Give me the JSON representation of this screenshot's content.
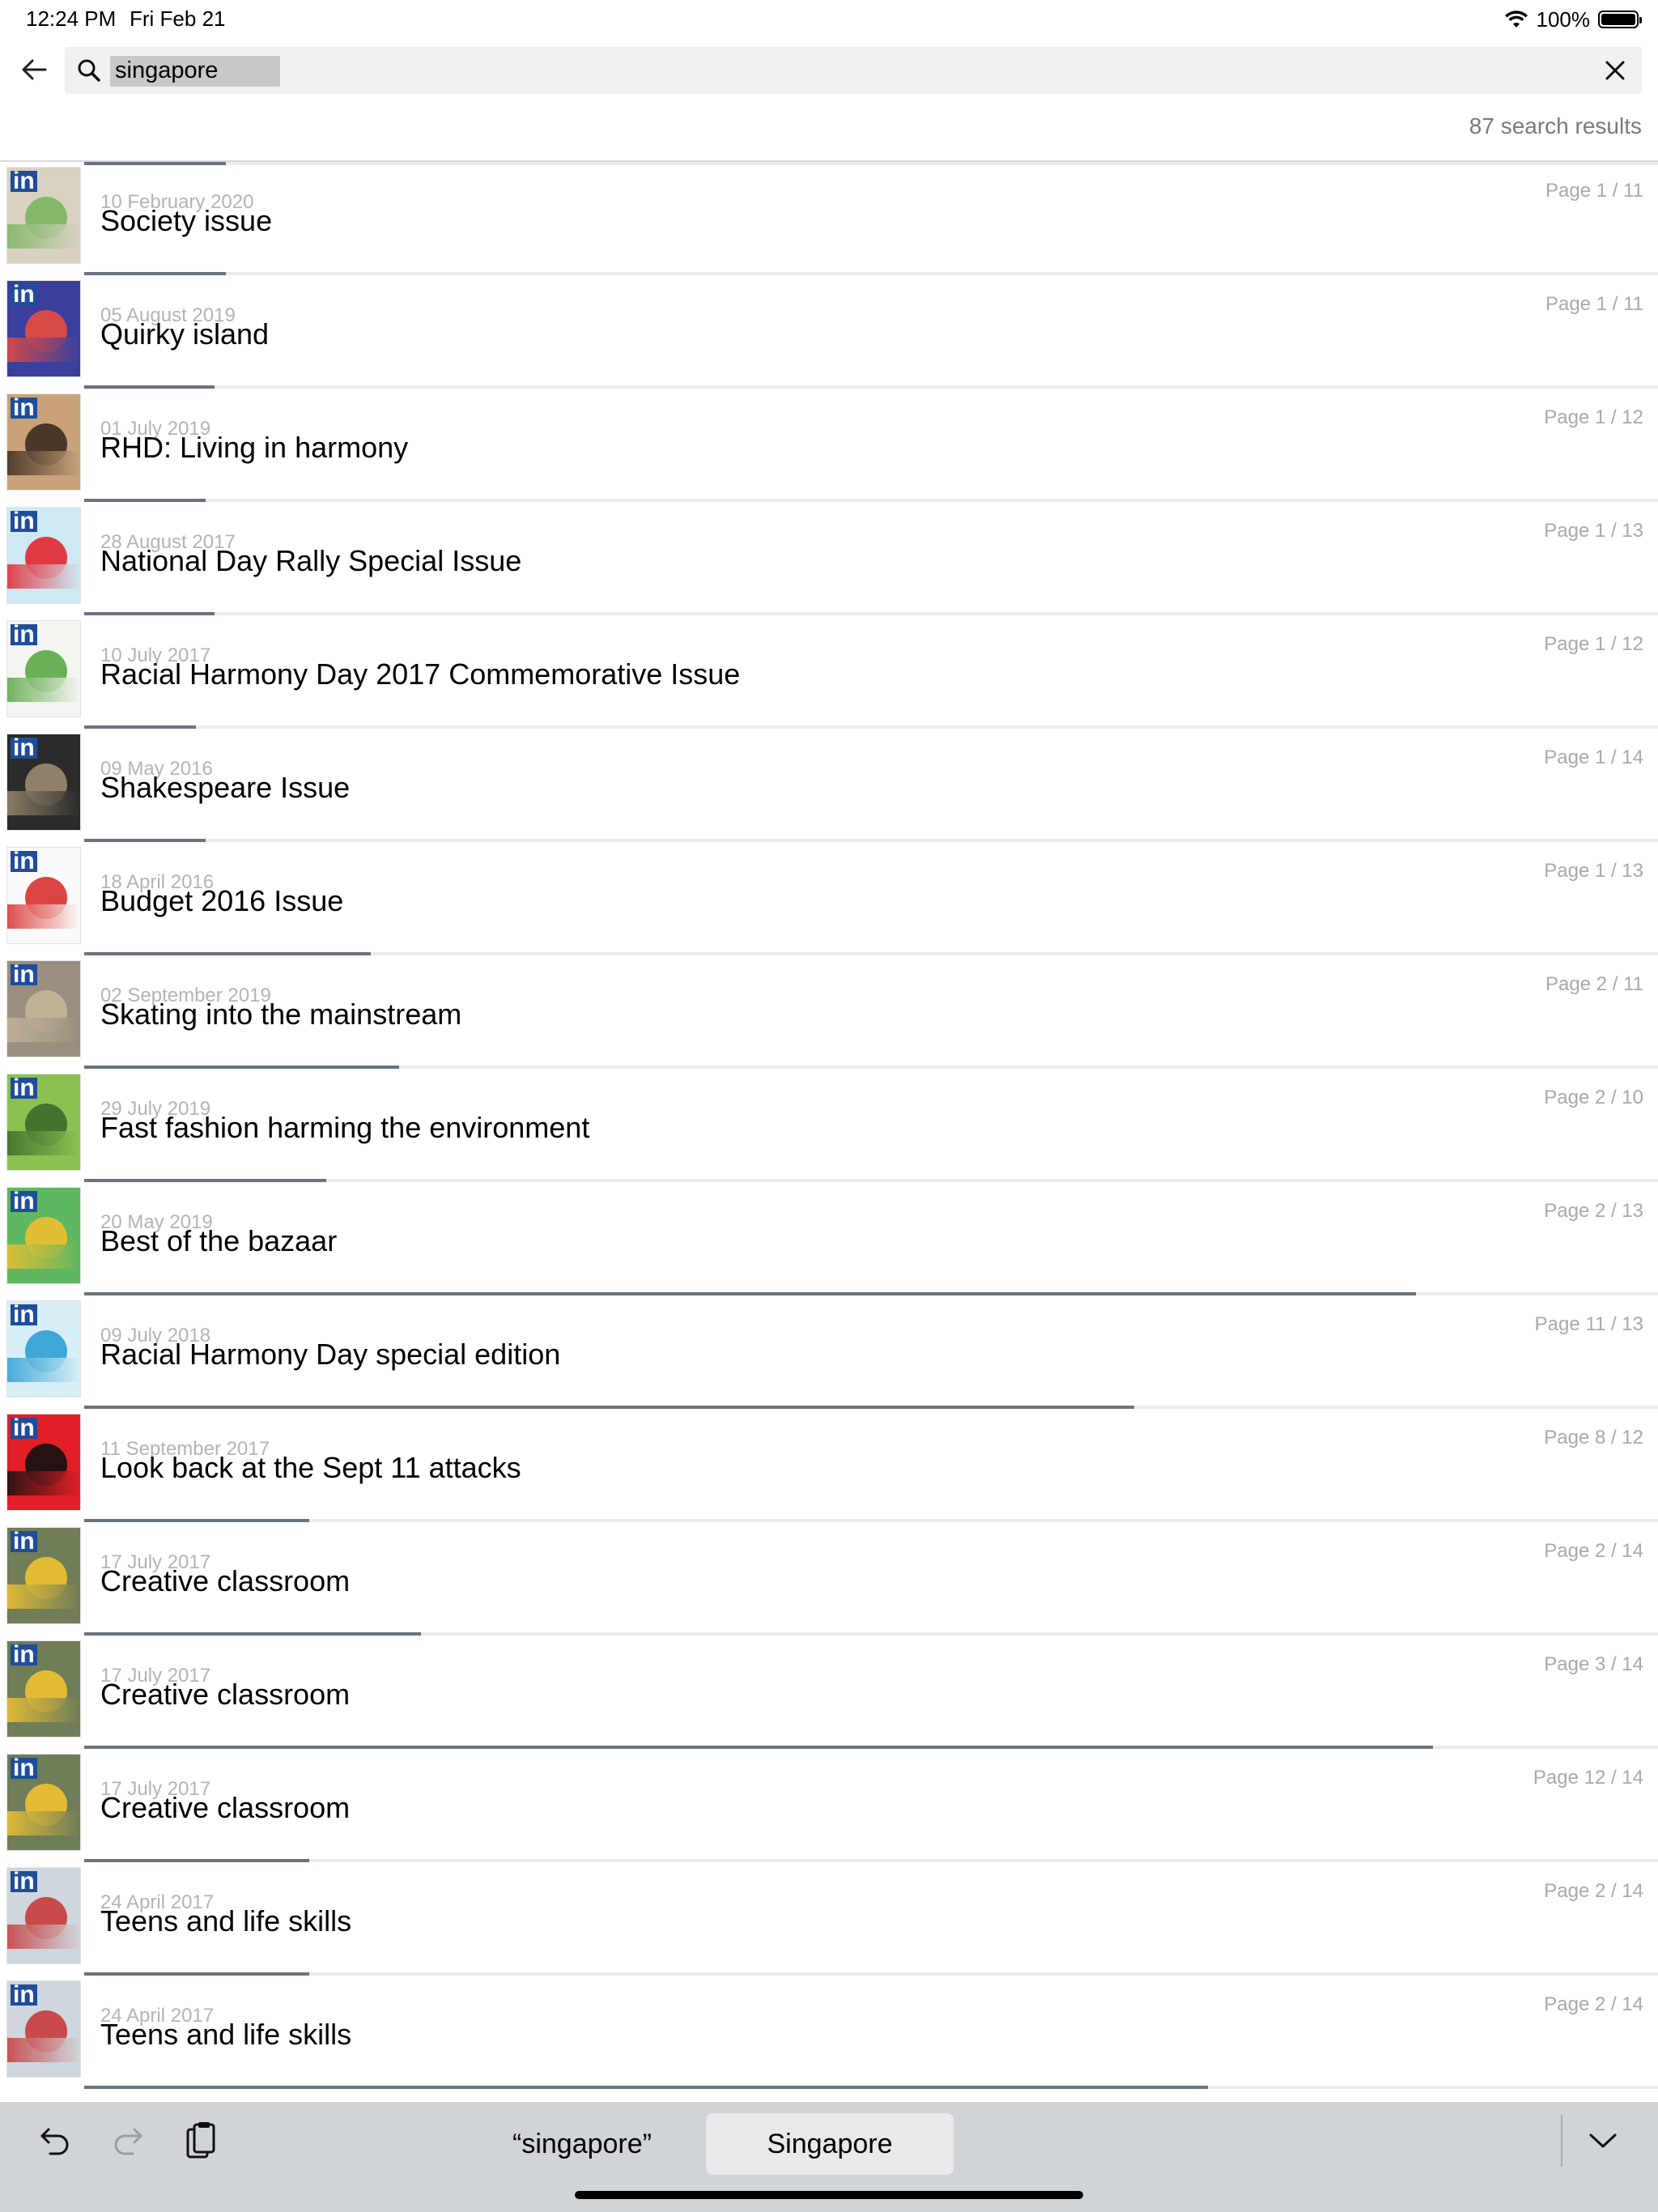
{
  "status_bar": {
    "time": "12:24 PM",
    "date": "Fri Feb 21",
    "battery": "100%",
    "icons": [
      "wifi-icon",
      "battery-icon"
    ]
  },
  "search": {
    "query": "singapore",
    "placeholder": "",
    "results_count": "87 search results"
  },
  "results": [
    {
      "date": "10 February 2020",
      "title": "Society issue",
      "page": "Page 1 / 11",
      "progress": 0.09,
      "cover": "#d9d2c2",
      "accent": "#7bb661"
    },
    {
      "date": "05 August 2019",
      "title": "Quirky island",
      "page": "Page 1 / 11",
      "progress": 0.09,
      "cover": "#3a3f9e",
      "accent": "#e84c3d"
    },
    {
      "date": "01 July 2019",
      "title": "RHD: Living in harmony",
      "page": "Page 1 / 12",
      "progress": 0.083,
      "cover": "#c9a27a",
      "accent": "#3d2b1f"
    },
    {
      "date": "28 August 2017",
      "title": "National Day Rally Special Issue",
      "page": "Page 1 / 13",
      "progress": 0.077,
      "cover": "#cfe9f3",
      "accent": "#e2262f"
    },
    {
      "date": "10 July 2017",
      "title": "Racial Harmony Day 2017 Commemorative Issue",
      "page": "Page 1 / 12",
      "progress": 0.083,
      "cover": "#f4f4f0",
      "accent": "#5aa845"
    },
    {
      "date": "09 May 2016",
      "title": "Shakespeare Issue",
      "page": "Page 1 / 14",
      "progress": 0.071,
      "cover": "#2b2b2b",
      "accent": "#9b8a6e"
    },
    {
      "date": "18 April 2016",
      "title": "Budget 2016 Issue",
      "page": "Page 1 / 13",
      "progress": 0.077,
      "cover": "#fafafa",
      "accent": "#d7322f"
    },
    {
      "date": "02 September 2019",
      "title": "Skating into the mainstream",
      "page": "Page 2 / 11",
      "progress": 0.182,
      "cover": "#9a8f7e",
      "accent": "#c4b59a"
    },
    {
      "date": "29 July 2019",
      "title": "Fast fashion harming the environment",
      "page": "Page 2 / 10",
      "progress": 0.2,
      "cover": "#8cc152",
      "accent": "#3b6b2a"
    },
    {
      "date": "20 May 2019",
      "title": "Best of the bazaar",
      "page": "Page 2 / 13",
      "progress": 0.154,
      "cover": "#5fb760",
      "accent": "#f0c030"
    },
    {
      "date": "09 July 2018",
      "title": "Racial Harmony Day special edition",
      "page": "Page 11 / 13",
      "progress": 0.846,
      "cover": "#d7eef7",
      "accent": "#2f9fd4"
    },
    {
      "date": "11 September 2017",
      "title": "Look back at the Sept 11 attacks",
      "page": "Page 8 / 12",
      "progress": 0.667,
      "cover": "#e21f26",
      "accent": "#111111"
    },
    {
      "date": "17 July 2017",
      "title": "Creative classroom",
      "page": "Page 2 / 14",
      "progress": 0.143,
      "cover": "#6f7d58",
      "accent": "#f1c232"
    },
    {
      "date": "17 July 2017",
      "title": "Creative classroom",
      "page": "Page 3 / 14",
      "progress": 0.214,
      "cover": "#6f7d58",
      "accent": "#f1c232"
    },
    {
      "date": "17 July 2017",
      "title": "Creative classroom",
      "page": "Page 12 / 14",
      "progress": 0.857,
      "cover": "#6f7d58",
      "accent": "#f1c232"
    },
    {
      "date": "24 April 2017",
      "title": "Teens and life skills",
      "page": "Page 2 / 14",
      "progress": 0.143,
      "cover": "#cfd6dd",
      "accent": "#c63b3b"
    },
    {
      "date": "24 April 2017",
      "title": "Teens and life skills",
      "page": "Page 2 / 14",
      "progress": 0.143,
      "cover": "#cfd6dd",
      "accent": "#c63b3b"
    }
  ],
  "last_row_progress": 0.714,
  "keyboard_bar": {
    "suggestions": [
      "“singapore”",
      "Singapore"
    ],
    "selected_index": 1,
    "icons": [
      "undo-icon",
      "redo-icon",
      "paste-icon",
      "dismiss-keyboard-icon"
    ]
  },
  "colors": {
    "progress": "#6b7280",
    "keyboard_bg": "#d0d3d8",
    "search_bg": "#f0f0f0"
  }
}
